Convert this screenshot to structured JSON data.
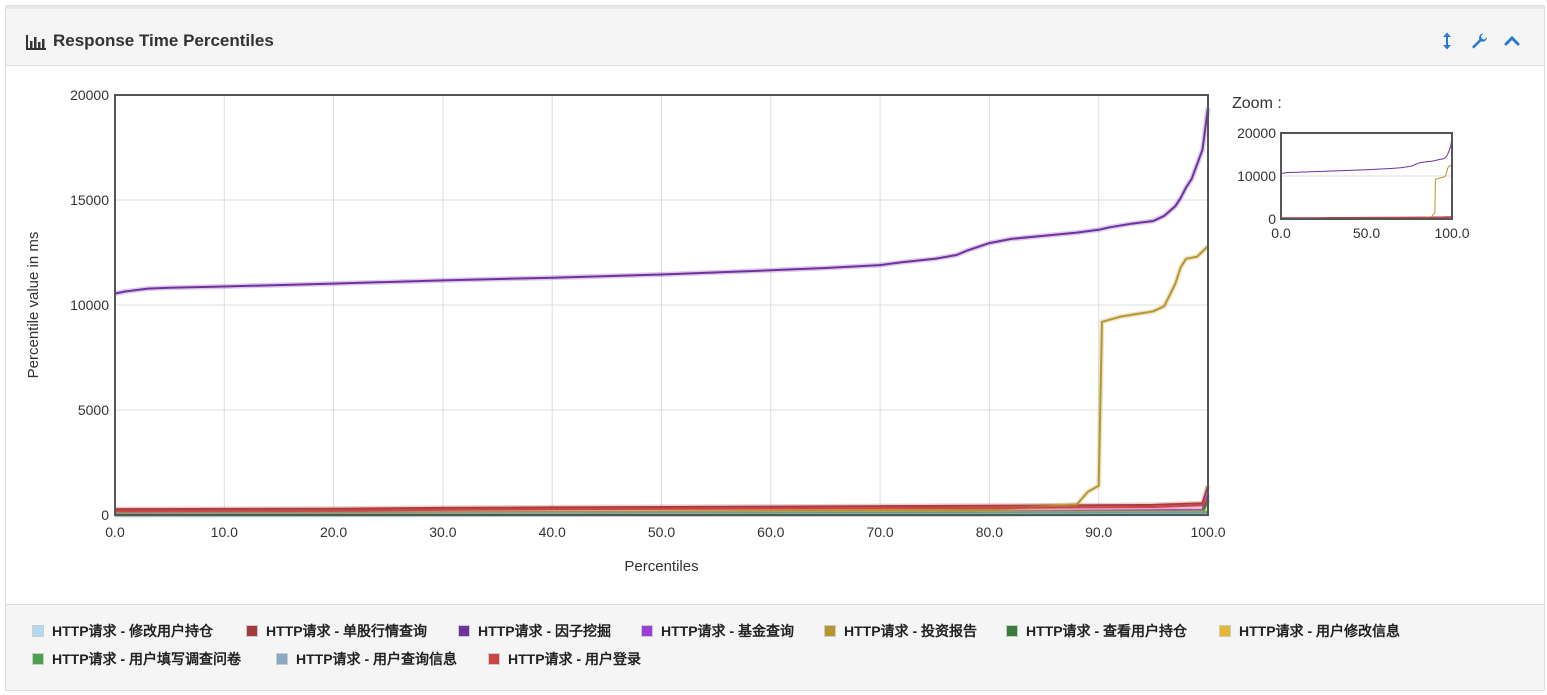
{
  "panel": {
    "title": "Response Time Percentiles",
    "title_icon": "bar-chart-icon",
    "buttons": [
      {
        "name": "resize-button",
        "icon": "vertical-arrows-icon"
      },
      {
        "name": "settings-button",
        "icon": "wrench-icon"
      },
      {
        "name": "collapse-button",
        "icon": "chevron-up-icon"
      }
    ]
  },
  "zoom": {
    "label": "Zoom :"
  },
  "colors": {
    "accent": "#2a7bd0",
    "grid": "#dddddd",
    "axis_frame": "#555555"
  },
  "chart_data": {
    "type": "line",
    "xlabel": "Percentiles",
    "ylabel": "Percentile value in ms",
    "xlim": [
      0,
      100
    ],
    "ylim": [
      0,
      20000
    ],
    "x_ticks": [
      "0.0",
      "10.0",
      "20.0",
      "30.0",
      "40.0",
      "50.0",
      "60.0",
      "70.0",
      "80.0",
      "90.0",
      "100.0"
    ],
    "y_ticks": [
      "0",
      "5000",
      "10000",
      "15000",
      "20000"
    ],
    "grid": true,
    "legend_position": "bottom",
    "zoom_chart": {
      "x_ticks": [
        "0.0",
        "50.0",
        "100.0"
      ],
      "y_ticks": [
        "0",
        "10000",
        "20000"
      ]
    },
    "series": [
      {
        "name": "HTTP请求 - 修改用户持仓",
        "color": "#b3d9f2",
        "x": [
          0,
          100
        ],
        "y": [
          20,
          40
        ]
      },
      {
        "name": "HTTP请求 - 单股行情查询",
        "color": "#a33a3a",
        "x": [
          0,
          20,
          30,
          40,
          60,
          80,
          95,
          99.5,
          100
        ],
        "y": [
          280,
          300,
          340,
          360,
          400,
          440,
          480,
          560,
          1400
        ]
      },
      {
        "name": "HTTP请求 - 因子挖掘",
        "color": "#7030a0",
        "x": [
          0,
          1,
          3,
          5,
          10,
          20,
          30,
          40,
          50,
          60,
          65,
          70,
          72,
          75,
          77,
          78,
          80,
          82,
          85,
          88,
          90,
          91,
          93,
          95,
          96,
          97,
          97.5,
          98,
          98.5,
          99,
          99.5,
          100
        ],
        "y": [
          10550,
          10650,
          10780,
          10820,
          10880,
          11020,
          11170,
          11300,
          11450,
          11650,
          11760,
          11900,
          12040,
          12200,
          12380,
          12600,
          12950,
          13150,
          13300,
          13450,
          13580,
          13700,
          13870,
          14000,
          14250,
          14700,
          15100,
          15600,
          16000,
          16700,
          17400,
          19400
        ]
      },
      {
        "name": "HTTP请求 - 基金查询",
        "color": "#9b3ed8",
        "x": [
          0,
          80,
          99.5,
          100
        ],
        "y": [
          100,
          160,
          250,
          1000
        ]
      },
      {
        "name": "HTTP请求 - 投资报告",
        "color": "#b8962e",
        "x": [
          0,
          50,
          80,
          88,
          89,
          90,
          90.3,
          92,
          95,
          96,
          97,
          97.5,
          98,
          99,
          100
        ],
        "y": [
          60,
          150,
          250,
          500,
          1100,
          1400,
          9200,
          9450,
          9700,
          9950,
          11000,
          11800,
          12200,
          12300,
          12800
        ]
      },
      {
        "name": "HTTP请求 - 查看用户持仓",
        "color": "#3a7d3a",
        "x": [
          0,
          80,
          99.5,
          100
        ],
        "y": [
          0,
          40,
          100,
          700
        ]
      },
      {
        "name": "HTTP请求 - 用户修改信息",
        "color": "#e6b830",
        "x": [
          0,
          100
        ],
        "y": [
          60,
          150
        ]
      },
      {
        "name": "HTTP请求 - 用户填写调查问卷",
        "color": "#4aa24a",
        "x": [
          0,
          100
        ],
        "y": [
          40,
          120
        ]
      },
      {
        "name": "HTTP请求 - 用户查询信息",
        "color": "#8aa8c2",
        "x": [
          0,
          100
        ],
        "y": [
          20,
          60
        ]
      },
      {
        "name": "HTTP请求 - 用户登录",
        "color": "#cc4444",
        "x": [
          0,
          20,
          30,
          40,
          60,
          80,
          95,
          99.5,
          100
        ],
        "y": [
          190,
          210,
          250,
          280,
          310,
          340,
          380,
          460,
          800
        ]
      }
    ]
  }
}
